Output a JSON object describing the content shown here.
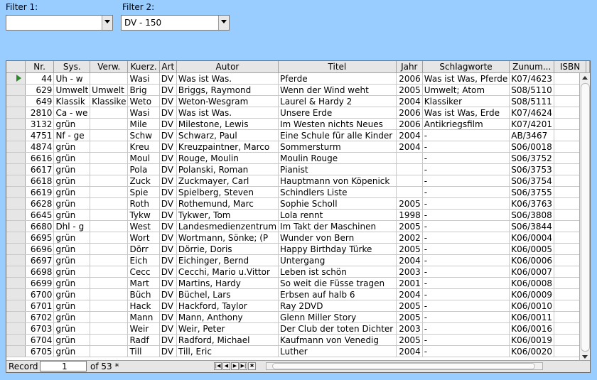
{
  "filters": {
    "filter1": {
      "label": "Filter 1:",
      "value": ""
    },
    "filter2": {
      "label": "Filter 2:",
      "value": "DV - 150"
    }
  },
  "grid": {
    "columns": [
      "Nr.",
      "Sys.",
      "Verw.",
      "Kuerz.",
      "Art",
      "Autor",
      "Titel",
      "Jahr",
      "Schlagworte",
      "Zunum...",
      "ISBN"
    ],
    "rows": [
      [
        "44",
        "Uh - w",
        "",
        "Wasi",
        "DV",
        "Was ist Was.",
        "Pferde",
        "2006",
        "Was ist Was, Pferde",
        "K07/4623",
        ""
      ],
      [
        "629",
        "Umwelt",
        "Umwelt",
        "Brig",
        "DV",
        "Briggs, Raymond",
        "Wenn der Wind weht",
        "2005",
        "Umwelt; Atom",
        "S08/5110",
        ""
      ],
      [
        "649",
        "Klassik",
        "Klassike",
        "Weto",
        "DV",
        "Weton-Wesgram",
        "Laurel & Hardy 2",
        "2004",
        "Klassiker",
        "S08/5111",
        ""
      ],
      [
        "2810",
        "Ca - we",
        "",
        "Wasi",
        "DV",
        "Was ist Was.",
        "Unsere Erde",
        "2006",
        "Was ist Was, Erde",
        "K07/4624",
        ""
      ],
      [
        "3132",
        "grün",
        "",
        "Mile",
        "DV",
        "Milestone, Lewis",
        "Im Westen nichts Neues",
        "2006",
        "Antikriegsfilm",
        "K07/4201",
        ""
      ],
      [
        "4751",
        "Nf - ge",
        "",
        "Schw",
        "DV",
        "Schwarz, Paul",
        "Eine Schule für alle Kinder",
        "2004",
        "-",
        "AB/3467",
        ""
      ],
      [
        "4874",
        "grün",
        "",
        "Kreu",
        "DV",
        "Kreuzpaintner, Marco",
        "Sommersturm",
        "2004",
        "-",
        "S06/0018",
        ""
      ],
      [
        "6616",
        "grün",
        "",
        "Moul",
        "DV",
        "Rouge, Moulin",
        "Moulin Rouge",
        "",
        "-",
        "S06/3752",
        ""
      ],
      [
        "6617",
        "grün",
        "",
        "Pola",
        "DV",
        "Polanski, Roman",
        "Pianist",
        "",
        "-",
        "S06/3753",
        ""
      ],
      [
        "6618",
        "grün",
        "",
        "Zuck",
        "DV",
        "Zuckmayer, Carl",
        "Hauptmann von Köpenick",
        "",
        "-",
        "S06/3754",
        ""
      ],
      [
        "6619",
        "grün",
        "",
        "Spie",
        "DV",
        "Spielberg, Steven",
        "Schindlers Liste",
        "",
        "-",
        "S06/3755",
        ""
      ],
      [
        "6628",
        "grün",
        "",
        "Roth",
        "DV",
        "Rothemund, Marc",
        "Sophie Scholl",
        "2005",
        "-",
        "K06/3763",
        ""
      ],
      [
        "6645",
        "grün",
        "",
        "Tykw",
        "DV",
        "Tykwer, Tom",
        "Lola rennt",
        "1998",
        "-",
        "S06/3808",
        ""
      ],
      [
        "6680",
        "Dhl - g",
        "",
        "West",
        "DV",
        "Landesmedienzentrum",
        "Im Takt der Maschinen",
        "2005",
        "-",
        "S06/3844",
        ""
      ],
      [
        "6695",
        "grün",
        "",
        "Wort",
        "DV",
        "Wortmann, Sönke; (P",
        "Wunder von Bern",
        "2002",
        "-",
        "K06/0004",
        ""
      ],
      [
        "6696",
        "grün",
        "",
        "Dörr",
        "DV",
        "Dörrie, Doris",
        "Happy Birthday Türke",
        "2005",
        "-",
        "K06/0005",
        ""
      ],
      [
        "6697",
        "grün",
        "",
        "Eich",
        "DV",
        "Eichinger, Bernd",
        "Untergang",
        "2004",
        "-",
        "K06/0006",
        ""
      ],
      [
        "6698",
        "grün",
        "",
        "Cecc",
        "DV",
        "Cecchi, Mario u.Vittor",
        "Leben ist schön",
        "2003",
        "-",
        "K06/0007",
        ""
      ],
      [
        "6699",
        "grün",
        "",
        "Mart",
        "DV",
        "Martins, Hardy",
        "So weit die Füsse tragen",
        "2001",
        "-",
        "K06/0008",
        ""
      ],
      [
        "6700",
        "grün",
        "",
        "Büch",
        "DV",
        "Büchel, Lars",
        "Erbsen auf halb 6",
        "2004",
        "-",
        "K06/0009",
        ""
      ],
      [
        "6701",
        "grün",
        "",
        "Hack",
        "DV",
        "Hackford, Taylor",
        "Ray 2DVD",
        "2005",
        "-",
        "K06/0010",
        ""
      ],
      [
        "6702",
        "grün",
        "",
        "Mann",
        "DV",
        "Mann, Anthony",
        "Glenn Miller Story",
        "2005",
        "-",
        "K06/0011",
        ""
      ],
      [
        "6703",
        "grün",
        "",
        "Weir",
        "DV",
        "Weir, Peter",
        "Der Club der toten Dichter",
        "2003",
        "-",
        "K06/0016",
        ""
      ],
      [
        "6704",
        "grün",
        "",
        "Radf",
        "DV",
        "Radford, Michael",
        "Kaufmann von Venedig",
        "2005",
        "-",
        "K06/0019",
        ""
      ],
      [
        "6705",
        "grün",
        "",
        "Till",
        "DV",
        "Till, Eric",
        "Luther",
        "2004",
        "-",
        "K06/0020",
        ""
      ]
    ]
  },
  "status": {
    "record_label": "Record",
    "record_value": "1",
    "of_text": "of 53 *"
  }
}
